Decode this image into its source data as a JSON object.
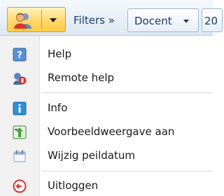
{
  "toolbar": {
    "user_menu_icon": "users-icon",
    "filters_label": "Filters »",
    "filter_chip_label": "Docent",
    "next_chip_label": "20"
  },
  "menu": {
    "items": [
      {
        "label": "Help",
        "icon": "help-icon"
      },
      {
        "label": "Remote help",
        "icon": "remote-help-icon"
      },
      {
        "label": "Info",
        "icon": "info-icon"
      },
      {
        "label": "Voorbeeldweergave aan",
        "icon": "preview-icon"
      },
      {
        "label": "Wijzig peildatum",
        "icon": "calendar-icon"
      },
      {
        "label": "Uitloggen",
        "icon": "logout-icon"
      }
    ]
  },
  "colors": {
    "toolbar_bg": "#dde8f3",
    "user_button_bg": "#ffd86b",
    "link_text": "#1f3d6b",
    "logout_red": "#d9342b"
  }
}
